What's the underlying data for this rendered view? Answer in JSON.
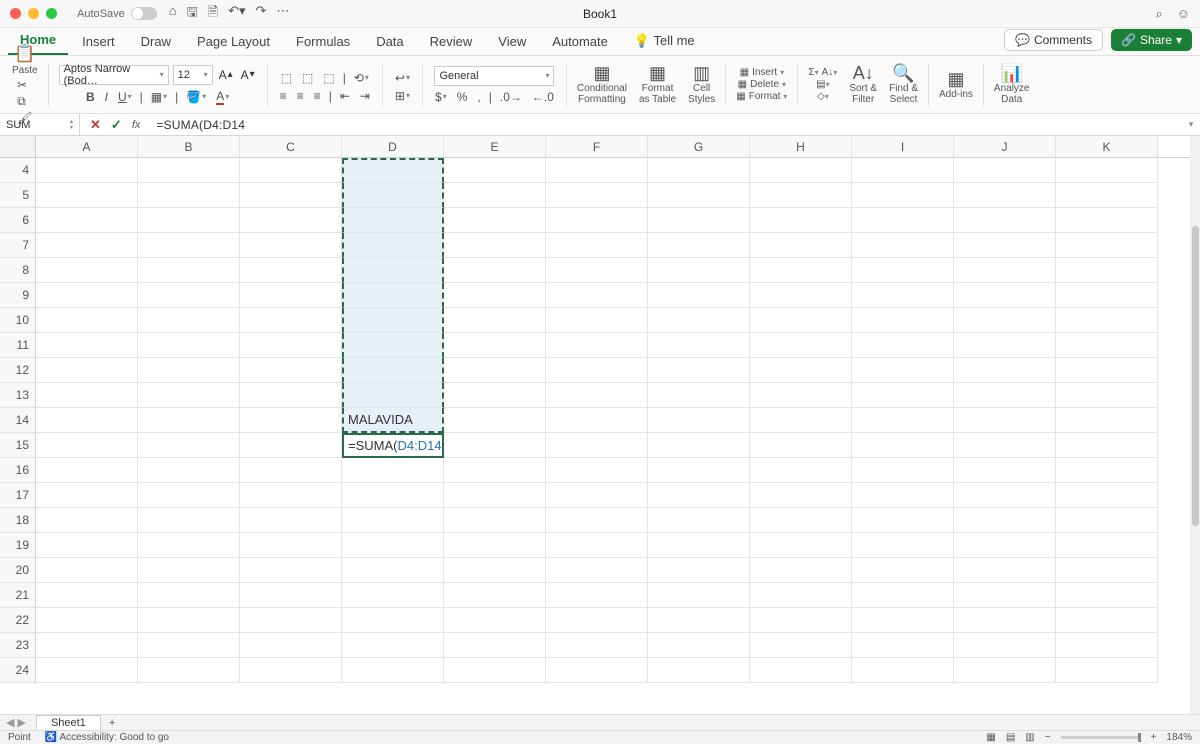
{
  "title": "Book1",
  "autosave_label": "AutoSave",
  "tabs": [
    "Home",
    "Insert",
    "Draw",
    "Page Layout",
    "Formulas",
    "Data",
    "Review",
    "View",
    "Automate"
  ],
  "tellme": "Tell me",
  "comments": "Comments",
  "share": "Share",
  "ribbon": {
    "paste": "Paste",
    "font_name": "Aptos Narrow (Bod…",
    "font_size": "12",
    "number_format": "General",
    "cond_fmt": "Conditional\nFormatting",
    "fmt_table": "Format\nas Table",
    "cell_styles": "Cell\nStyles",
    "insert": "Insert",
    "delete": "Delete",
    "format": "Format",
    "sort_filter": "Sort &\nFilter",
    "find_select": "Find &\nSelect",
    "addins": "Add-ins",
    "analyze": "Analyze\nData"
  },
  "namebox": "SUM",
  "formula": "=SUMA(D4:D14",
  "formula_parts": {
    "pre": "=SUMA(",
    "arg": "D4:D14"
  },
  "columns": [
    "A",
    "B",
    "C",
    "D",
    "E",
    "F",
    "G",
    "H",
    "I",
    "J",
    "K"
  ],
  "row_start": 4,
  "row_end": 24,
  "cells": {
    "D14": "MALAVIDA"
  },
  "active_cell_row": 15,
  "active_cell_col": "D",
  "selection": {
    "col": "D",
    "row_from": 4,
    "row_to": 14
  },
  "sheet": "Sheet1",
  "status_mode": "Point",
  "accessibility": "Accessibility: Good to go",
  "zoom": "184%"
}
